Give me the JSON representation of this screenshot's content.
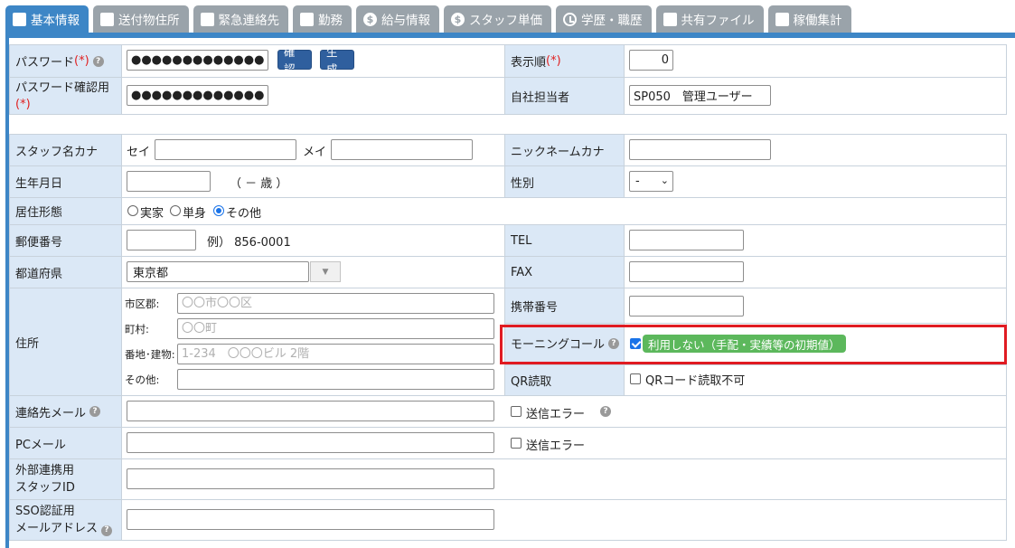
{
  "tabs": [
    {
      "label": "基本情報",
      "icon": "edit-icon",
      "active": true
    },
    {
      "label": "送付物住所",
      "icon": "edit-icon"
    },
    {
      "label": "緊急連絡先",
      "icon": "edit-icon"
    },
    {
      "label": "勤務",
      "icon": "edit-icon"
    },
    {
      "label": "給与情報",
      "icon": "dollar-icon"
    },
    {
      "label": "スタッフ単価",
      "icon": "dollar-icon"
    },
    {
      "label": "学歴・職歴",
      "icon": "clock-icon"
    },
    {
      "label": "共有ファイル",
      "icon": "edit-icon"
    },
    {
      "label": "稼働集計",
      "icon": "edit-icon"
    }
  ],
  "required_mark": "(*)",
  "password": {
    "label": "パスワード",
    "value": "●●●●●●●●●●●●●●●●",
    "confirm_btn": "確認",
    "generate_btn": "生成"
  },
  "password_confirm": {
    "label": "パスワード確認用",
    "value": "●●●●●●●●●●●●●●●●"
  },
  "display_order": {
    "label": "表示順",
    "value": "0"
  },
  "company_manager": {
    "label": "自社担当者",
    "value": "SP050　管理ユーザー"
  },
  "staff_kana": {
    "label": "スタッフ名カナ",
    "sei_label": "セイ",
    "mei_label": "メイ",
    "sei": "",
    "mei": ""
  },
  "nickname_kana": {
    "label": "ニックネームカナ",
    "value": ""
  },
  "birthdate": {
    "label": "生年月日",
    "value": "",
    "age_text": "（ － 歳 ）"
  },
  "gender": {
    "label": "性別",
    "selected": "-"
  },
  "residence": {
    "label": "居住形態",
    "options": [
      "実家",
      "単身",
      "その他"
    ],
    "selected": "その他"
  },
  "postal": {
    "label": "郵便番号",
    "value": "",
    "example": "例） 856-0001"
  },
  "tel": {
    "label": "TEL",
    "value": ""
  },
  "prefecture": {
    "label": "都道府県",
    "value": "東京都"
  },
  "fax": {
    "label": "FAX",
    "value": ""
  },
  "address": {
    "label": "住所",
    "city_label": "市区郡:",
    "city_placeholder": "〇〇市〇〇区",
    "town_label": "町村:",
    "town_placeholder": "〇〇町",
    "street_label": "番地･建物:",
    "street_placeholder": "1-234　〇〇〇ビル 2階",
    "other_label": "その他:"
  },
  "mobile": {
    "label": "携帯番号",
    "value": ""
  },
  "morning_call": {
    "label": "モーニングコール",
    "checked": true,
    "badge": "利用しない（手配・実績等の初期値）"
  },
  "qr": {
    "label": "QR読取",
    "checkbox_label": "QRコード読取不可",
    "checked": false
  },
  "contact_mail": {
    "label": "連絡先メール",
    "value": "",
    "error_label": "送信エラー"
  },
  "pc_mail": {
    "label": "PCメール",
    "value": "",
    "error_label": "送信エラー"
  },
  "external_id": {
    "label_line1": "外部連携用",
    "label_line2": "スタッフID",
    "value": ""
  },
  "sso_mail": {
    "label_line1": "SSO認証用",
    "label_line2": "メールアドレス",
    "value": ""
  },
  "colors": {
    "tab_active": "#3d86c6",
    "tab_inactive": "#9aa3aa",
    "label_bg": "#dbe8f6",
    "highlight": "#e01b22",
    "badge": "#5cb85c",
    "button": "#2f5f9e"
  }
}
